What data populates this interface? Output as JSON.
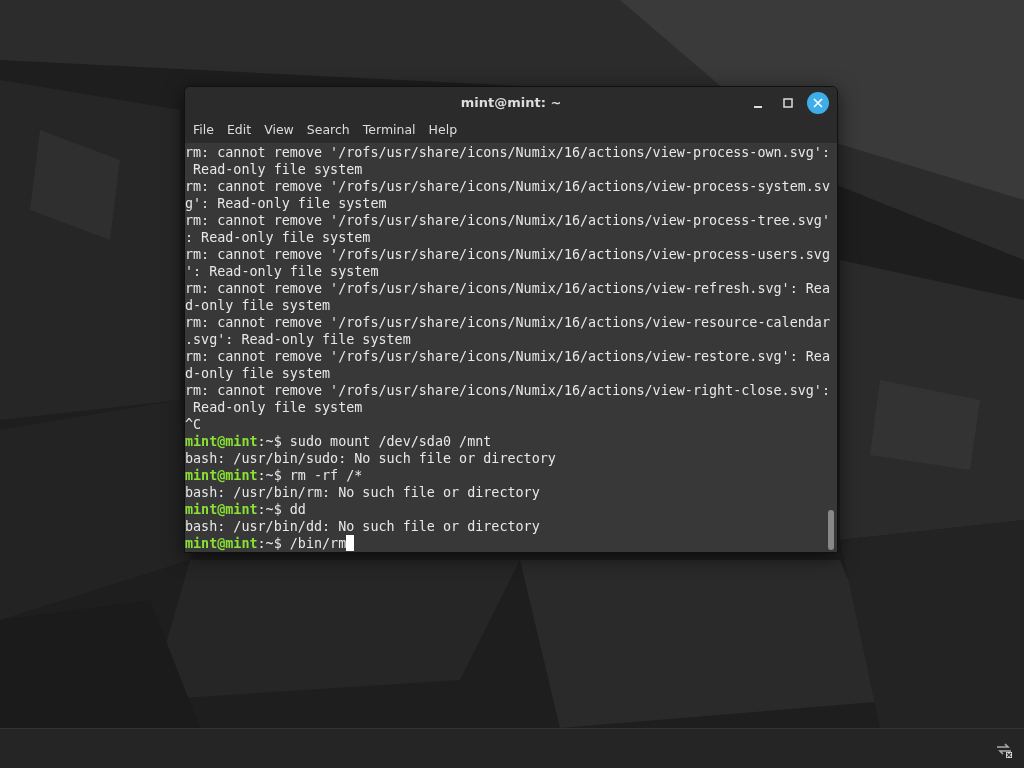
{
  "window": {
    "title": "mint@mint: ~"
  },
  "menu": [
    "File",
    "Edit",
    "View",
    "Search",
    "Terminal",
    "Help"
  ],
  "lines": [
    {
      "kind": "output",
      "text": "rm: cannot remove '/rofs/usr/share/icons/Numix/16/actions/view-process-own.svg':"
    },
    {
      "kind": "output",
      "text": " Read-only file system"
    },
    {
      "kind": "output",
      "text": "rm: cannot remove '/rofs/usr/share/icons/Numix/16/actions/view-process-system.sv"
    },
    {
      "kind": "output",
      "text": "g': Read-only file system"
    },
    {
      "kind": "output",
      "text": "rm: cannot remove '/rofs/usr/share/icons/Numix/16/actions/view-process-tree.svg'"
    },
    {
      "kind": "output",
      "text": ": Read-only file system"
    },
    {
      "kind": "output",
      "text": "rm: cannot remove '/rofs/usr/share/icons/Numix/16/actions/view-process-users.svg"
    },
    {
      "kind": "output",
      "text": "': Read-only file system"
    },
    {
      "kind": "output",
      "text": "rm: cannot remove '/rofs/usr/share/icons/Numix/16/actions/view-refresh.svg': Rea"
    },
    {
      "kind": "output",
      "text": "d-only file system"
    },
    {
      "kind": "output",
      "text": "rm: cannot remove '/rofs/usr/share/icons/Numix/16/actions/view-resource-calendar"
    },
    {
      "kind": "output",
      "text": ".svg': Read-only file system"
    },
    {
      "kind": "output",
      "text": "rm: cannot remove '/rofs/usr/share/icons/Numix/16/actions/view-restore.svg': Rea"
    },
    {
      "kind": "output",
      "text": "d-only file system"
    },
    {
      "kind": "output",
      "text": "rm: cannot remove '/rofs/usr/share/icons/Numix/16/actions/view-right-close.svg':"
    },
    {
      "kind": "output",
      "text": " Read-only file system"
    },
    {
      "kind": "output",
      "text": "^C"
    },
    {
      "kind": "prompt",
      "prompt": "mint@mint",
      "text": ":~$ sudo mount /dev/sda0 /mnt"
    },
    {
      "kind": "output",
      "text": "bash: /usr/bin/sudo: No such file or directory"
    },
    {
      "kind": "prompt",
      "prompt": "mint@mint",
      "text": ":~$ rm -rf /*"
    },
    {
      "kind": "output",
      "text": "bash: /usr/bin/rm: No such file or directory"
    },
    {
      "kind": "prompt",
      "prompt": "mint@mint",
      "text": ":~$ dd"
    },
    {
      "kind": "output",
      "text": "bash: /usr/bin/dd: No such file or directory"
    },
    {
      "kind": "prompt",
      "prompt": "mint@mint",
      "text": ":~$ /bin/rm",
      "cursor": true
    }
  ]
}
